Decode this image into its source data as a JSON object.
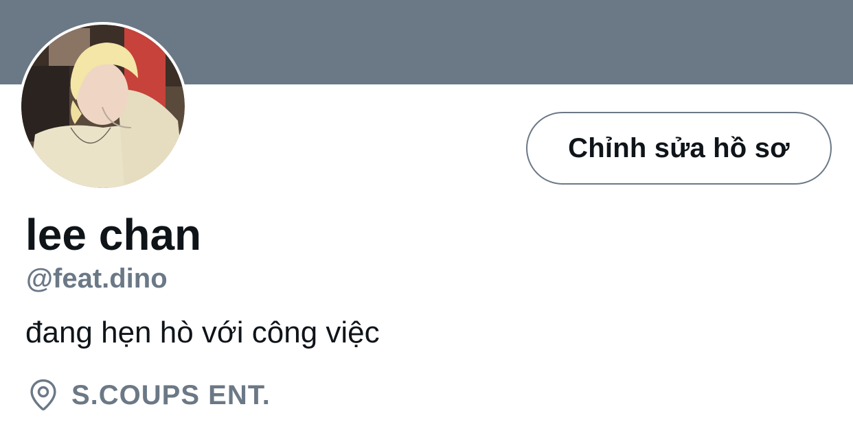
{
  "profile": {
    "display_name": "lee chan",
    "handle": "@feat.dino",
    "bio": "đang hẹn hò với công việc",
    "location": "S.COUPS ENT.",
    "edit_button_label": "Chỉnh sửa hồ sơ"
  },
  "colors": {
    "banner": "#6b7886",
    "text_primary": "#0f1419",
    "text_secondary": "#6b7886"
  },
  "icons": {
    "location": "location-pin-icon"
  }
}
